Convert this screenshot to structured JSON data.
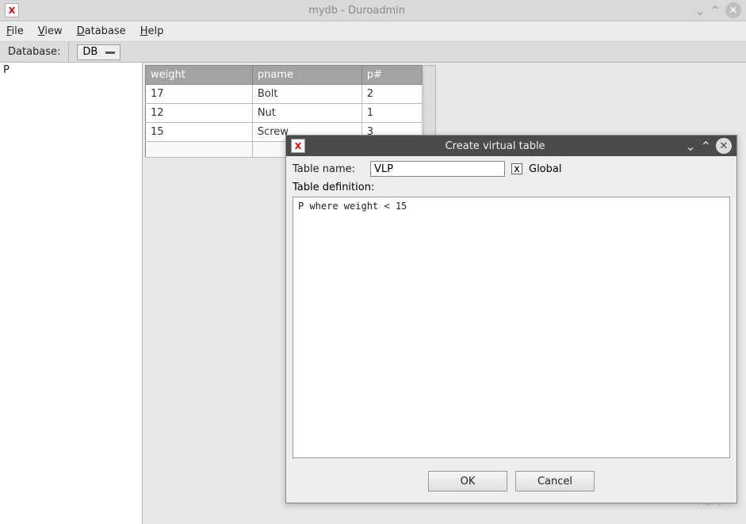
{
  "window": {
    "title": "mydb - Duroadmin"
  },
  "menu": {
    "file": "File",
    "view": "View",
    "database": "Database",
    "help": "Help"
  },
  "dbbar": {
    "label": "Database:",
    "selected": "DB"
  },
  "sidebar": {
    "items": [
      "P"
    ]
  },
  "table": {
    "columns": [
      "weight",
      "pname",
      "p#"
    ],
    "rows": [
      {
        "weight": "17",
        "pname": "Bolt",
        "pnum": "2"
      },
      {
        "weight": "12",
        "pname": "Nut",
        "pnum": "1"
      },
      {
        "weight": "15",
        "pname": "Screw",
        "pnum": "3"
      }
    ]
  },
  "dialog": {
    "title": "Create virtual table",
    "table_name_label": "Table name:",
    "table_name_value": "VLP",
    "global_label": "Global",
    "global_checked": "x",
    "definition_label": "Table definition:",
    "definition_value": "P where weight < 15",
    "ok": "OK",
    "cancel": "Cancel"
  },
  "ghost": {
    "more": "More"
  }
}
